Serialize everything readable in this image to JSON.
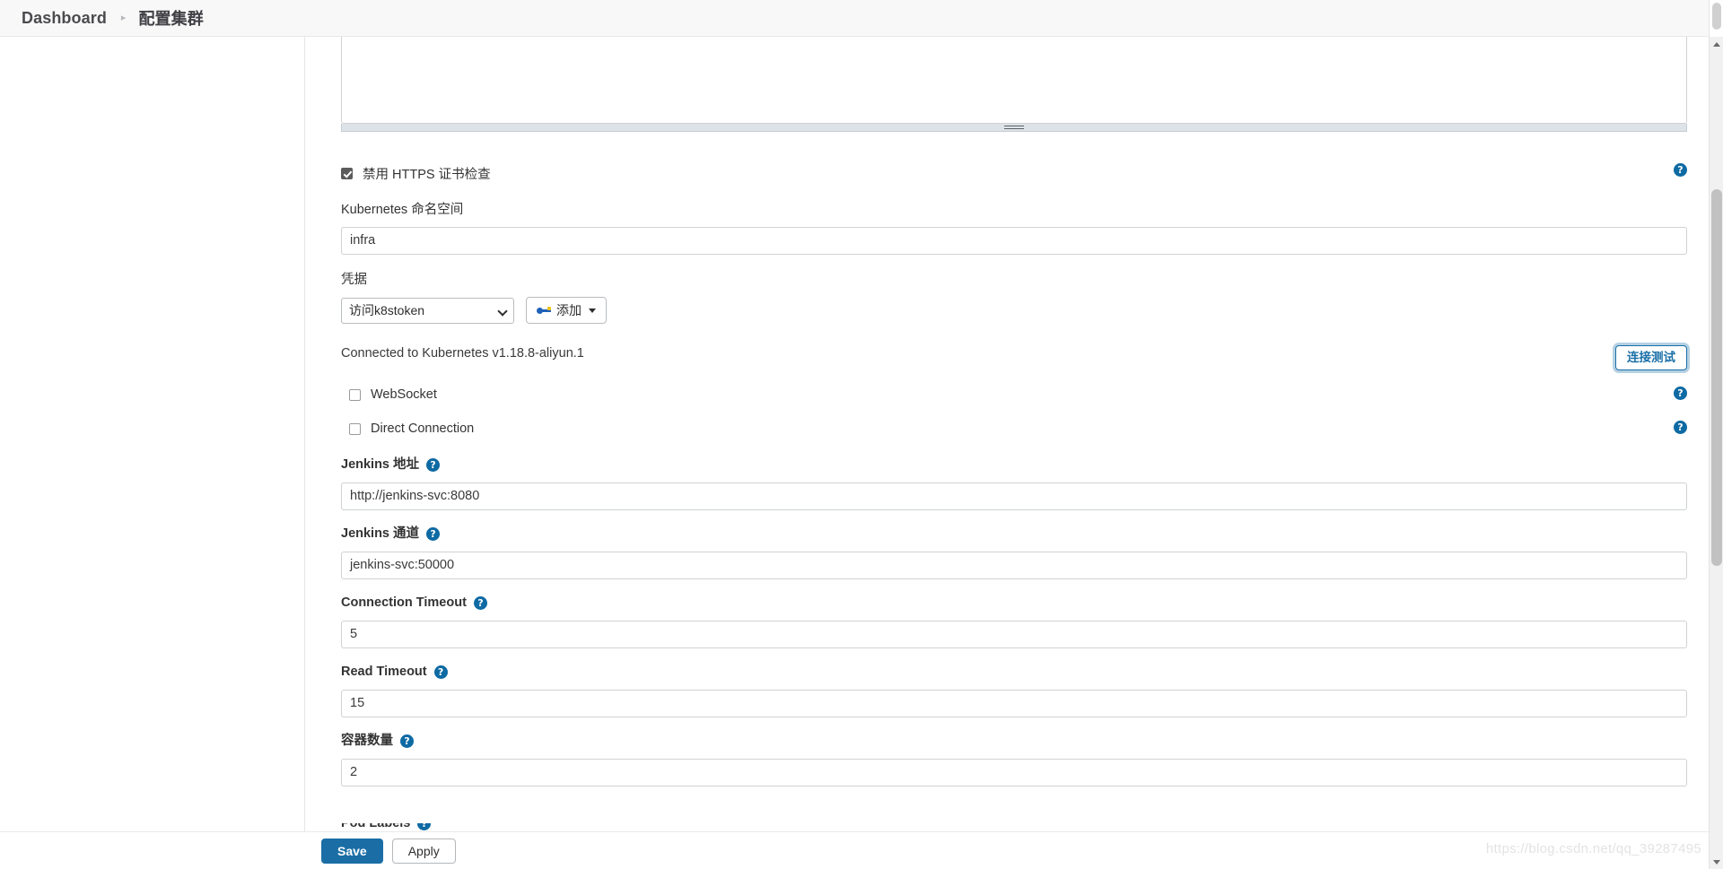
{
  "breadcrumb": {
    "home": "Dashboard",
    "separator": "▸",
    "leaf": "配置集群"
  },
  "form": {
    "disable_https_check": {
      "label": "禁用 HTTPS 证书检查",
      "checked": "true",
      "help": "?"
    },
    "namespace": {
      "label": "Kubernetes 命名空间",
      "value": "infra"
    },
    "credentials": {
      "label": "凭据",
      "selected": "访问k8stoken",
      "add_label": "添加",
      "add_icon": "key-icon"
    },
    "connection": {
      "status": "Connected to Kubernetes v1.18.8-aliyun.1",
      "test_button": "连接测试"
    },
    "websocket": {
      "label": "WebSocket",
      "checked": "false",
      "help": "?"
    },
    "direct_connection": {
      "label": "Direct Connection",
      "checked": "false",
      "help": "?"
    },
    "jenkins_url": {
      "label": "Jenkins 地址",
      "help": "?",
      "value": "http://jenkins-svc:8080"
    },
    "jenkins_tunnel": {
      "label": "Jenkins 通道",
      "help": "?",
      "value": "jenkins-svc:50000"
    },
    "connection_timeout": {
      "label": "Connection Timeout",
      "help": "?",
      "value": "5"
    },
    "read_timeout": {
      "label": "Read Timeout",
      "help": "?",
      "value": "15"
    },
    "container_cap": {
      "label": "容器数量",
      "help": "?",
      "value": "2"
    },
    "pod_labels": {
      "label": "Pod Labels",
      "help": "?"
    }
  },
  "actions": {
    "save": "Save",
    "apply": "Apply"
  },
  "watermark": "https://blog.csdn.net/qq_39287495",
  "colors": {
    "accent": "#1a6ea5",
    "help_icon": "#0e6aa3",
    "key_icon": "#1f62b8"
  }
}
